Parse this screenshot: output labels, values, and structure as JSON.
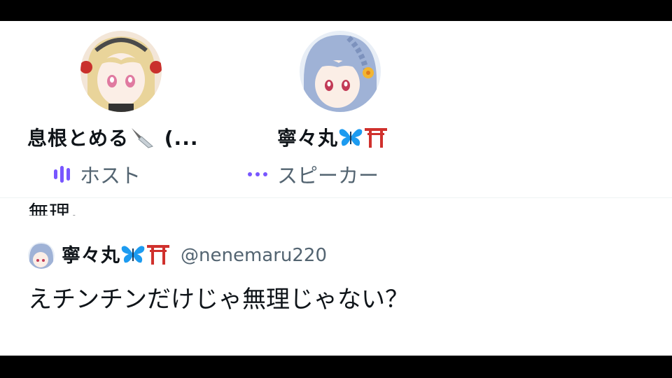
{
  "speakers": [
    {
      "name": "息根とめる",
      "name_suffix": " (...",
      "name_emoji": [
        "knife-icon"
      ],
      "role": "ホスト",
      "role_icon": "audio-wave-icon",
      "avatar": "avatar-blonde-girl"
    },
    {
      "name": "寧々丸",
      "name_emoji": [
        "butterfly-icon",
        "torii-icon"
      ],
      "role": "スピーカー",
      "role_icon": "dots-icon",
      "avatar": "avatar-bluehair-girl"
    }
  ],
  "previous_post": {
    "text": "無理。"
  },
  "quoted_post": {
    "author_name": "寧々丸",
    "author_emoji": [
      "butterfly-icon",
      "torii-icon"
    ],
    "handle": "@nenemaru220",
    "text": "えチンチンだけじゃ無理じゃない？"
  },
  "colors": {
    "accent": "#7856ff",
    "text": "#0f1419",
    "secondary_text": "#536471",
    "butterfly": "#1d9bf0",
    "torii": "#d0312d"
  }
}
